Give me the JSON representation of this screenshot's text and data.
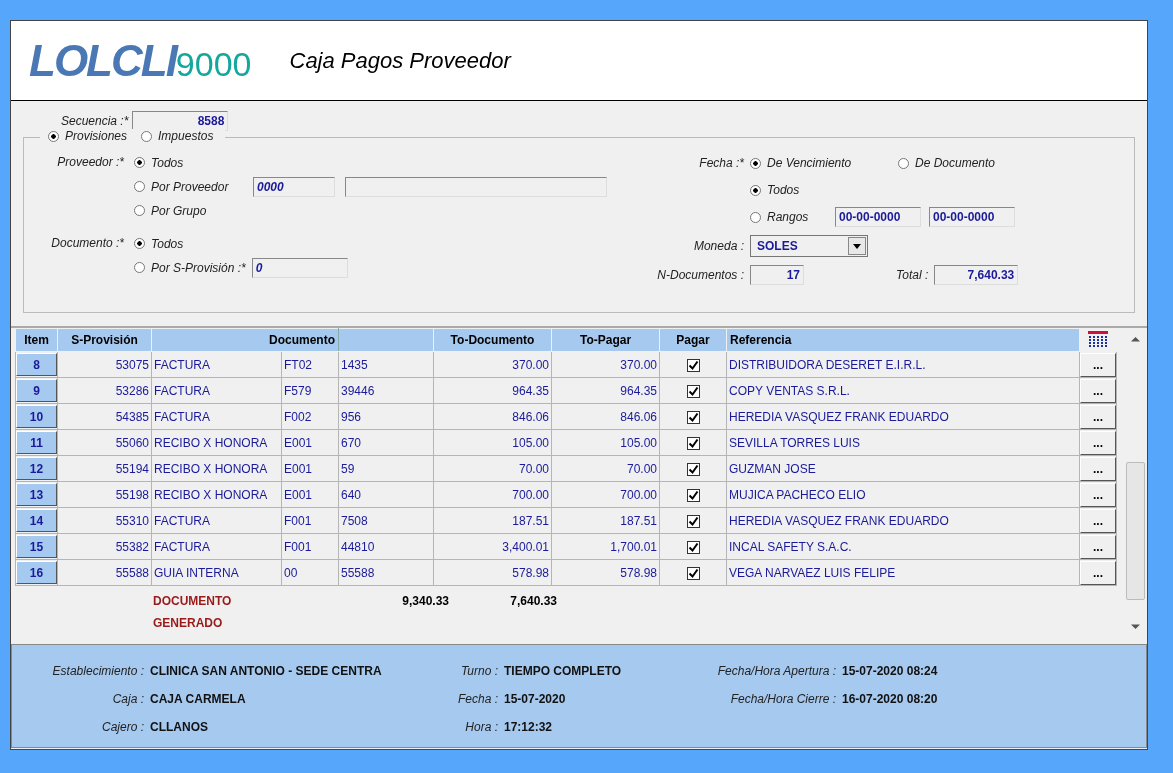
{
  "header": {
    "logo": "LOLCLI",
    "logo_suffix": "9000",
    "title": "Caja Pagos Proveedor"
  },
  "form": {
    "secuencia_label": "Secuencia :*",
    "secuencia": "8588",
    "tipo": [
      {
        "label": "Provisiones",
        "selected": true
      },
      {
        "label": "Impuestos",
        "selected": false
      }
    ],
    "proveedor_label": "Proveedor :*",
    "proveedor": [
      {
        "label": "Todos",
        "selected": true
      },
      {
        "label": "Por Proveedor",
        "selected": false
      },
      {
        "label": "Por Grupo",
        "selected": false
      }
    ],
    "proveedor_code": "0000",
    "documento_label": "Documento :*",
    "documento": [
      {
        "label": "Todos",
        "selected": true
      },
      {
        "label": "Por S-Provisión :*",
        "selected": false
      }
    ],
    "s_provision": "0",
    "fecha_label": "Fecha :*",
    "fecha_tipo": [
      {
        "label": "De Vencimiento",
        "selected": true
      },
      {
        "label": "De Documento",
        "selected": false
      }
    ],
    "fecha_rango": [
      {
        "label": "Todos",
        "selected": true
      },
      {
        "label": "Rangos",
        "selected": false
      }
    ],
    "fecha_desde": "00-00-0000",
    "fecha_hasta": "00-00-0000",
    "moneda_label": "Moneda :",
    "moneda": "SOLES",
    "n_documentos_label": "N-Documentos :",
    "n_documentos": "17",
    "total_label": "Total :",
    "total": "7,640.33"
  },
  "table": {
    "columns": [
      "Item",
      "S-Provisión",
      "Documento",
      "To-Documento",
      "To-Pagar",
      "Pagar",
      "Referencia"
    ],
    "rows": [
      {
        "item": "8",
        "s_provision": "53075",
        "documento": "FACTURA",
        "serie": "FT02",
        "numero": "1435",
        "to_documento": "370.00",
        "to_pagar": "370.00",
        "pagar": true,
        "referencia": "DISTRIBUIDORA DESERET E.I.R.L.",
        "action": "..."
      },
      {
        "item": "9",
        "s_provision": "53286",
        "documento": "FACTURA",
        "serie": "F579",
        "numero": "39446",
        "to_documento": "964.35",
        "to_pagar": "964.35",
        "pagar": true,
        "referencia": "COPY VENTAS S.R.L.",
        "action": "..."
      },
      {
        "item": "10",
        "s_provision": "54385",
        "documento": "FACTURA",
        "serie": "F002",
        "numero": "956",
        "to_documento": "846.06",
        "to_pagar": "846.06",
        "pagar": true,
        "referencia": "HEREDIA VASQUEZ FRANK EDUARDO",
        "action": "..."
      },
      {
        "item": "11",
        "s_provision": "55060",
        "documento": "RECIBO X HONORA",
        "serie": "E001",
        "numero": "670",
        "to_documento": "105.00",
        "to_pagar": "105.00",
        "pagar": true,
        "referencia": "SEVILLA TORRES LUIS",
        "action": "..."
      },
      {
        "item": "12",
        "s_provision": "55194",
        "documento": "RECIBO X HONORA",
        "serie": "E001",
        "numero": "59",
        "to_documento": "70.00",
        "to_pagar": "70.00",
        "pagar": true,
        "referencia": "GUZMAN JOSE",
        "action": "..."
      },
      {
        "item": "13",
        "s_provision": "55198",
        "documento": "RECIBO X HONORA",
        "serie": "E001",
        "numero": "640",
        "to_documento": "700.00",
        "to_pagar": "700.00",
        "pagar": true,
        "referencia": "MUJICA PACHECO ELIO",
        "action": "..."
      },
      {
        "item": "14",
        "s_provision": "55310",
        "documento": "FACTURA",
        "serie": "F001",
        "numero": "7508",
        "to_documento": "187.51",
        "to_pagar": "187.51",
        "pagar": true,
        "referencia": "HEREDIA VASQUEZ FRANK EDUARDO",
        "action": "..."
      },
      {
        "item": "15",
        "s_provision": "55382",
        "documento": "FACTURA",
        "serie": "F001",
        "numero": "44810",
        "to_documento": "3,400.01",
        "to_pagar": "1,700.01",
        "pagar": true,
        "referencia": "INCAL SAFETY S.A.C.",
        "action": "..."
      },
      {
        "item": "16",
        "s_provision": "55588",
        "documento": "GUIA INTERNA",
        "serie": "00",
        "numero": "55588",
        "to_documento": "578.98",
        "to_pagar": "578.98",
        "pagar": true,
        "referencia": "VEGA NARVAEZ LUIS FELIPE",
        "action": "..."
      }
    ],
    "status": [
      "DOCUMENTO",
      "GENERADO"
    ],
    "total_documento": "9,340.33",
    "total_pagar": "7,640.33"
  },
  "footer": [
    {
      "label": "Establecimiento :",
      "value": "CLINICA SAN ANTONIO - SEDE CENTRA"
    },
    {
      "label": "Turno :",
      "value": "TIEMPO COMPLETO"
    },
    {
      "label": "Fecha/Hora Apertura :",
      "value": "15-07-2020 08:24"
    },
    {
      "label": "Caja :",
      "value": "CAJA CARMELA"
    },
    {
      "label": "Fecha :",
      "value": "15-07-2020"
    },
    {
      "label": "Fecha/Hora Cierre :",
      "value": "16-07-2020 08:20"
    },
    {
      "label": "Cajero :",
      "value": "CLLANOS"
    },
    {
      "label": "Hora :",
      "value": "17:12:32"
    }
  ]
}
